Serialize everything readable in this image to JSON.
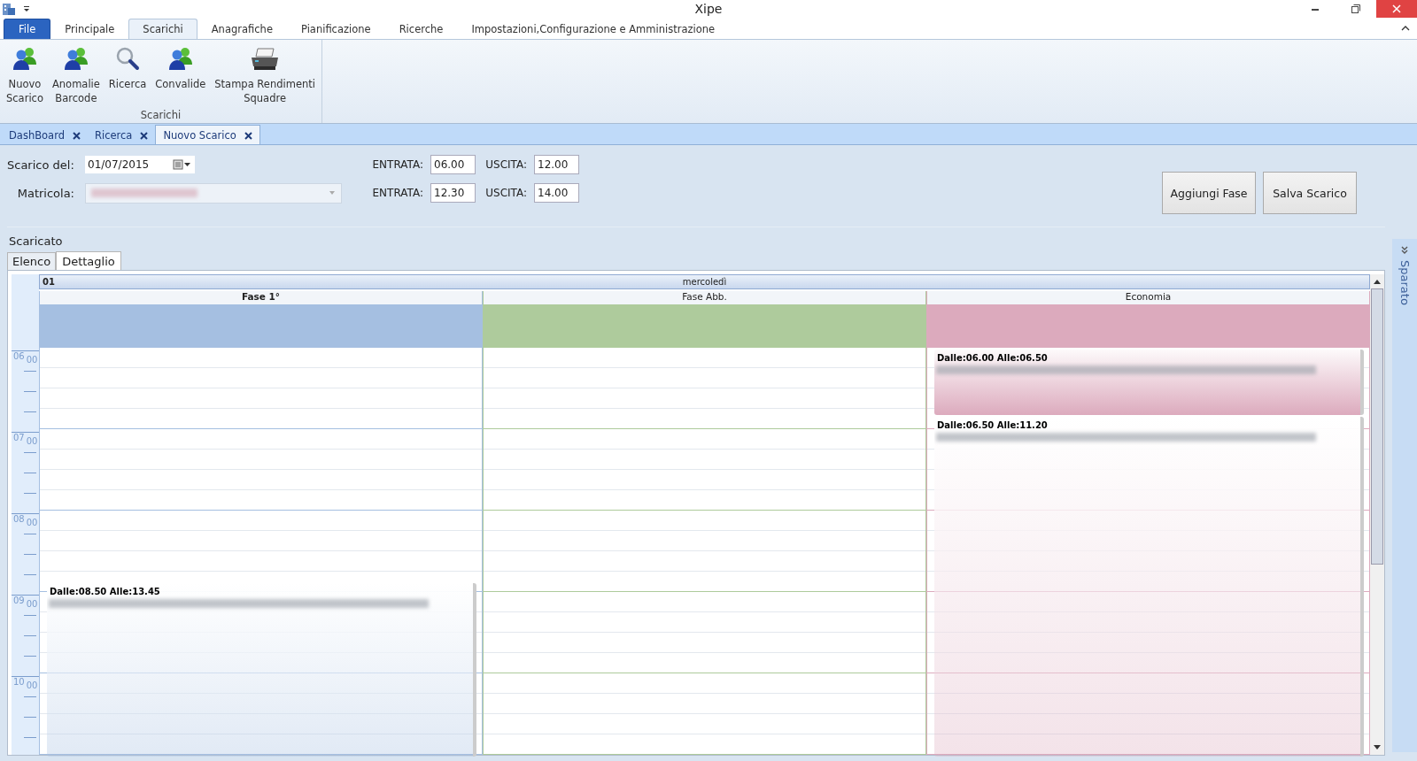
{
  "window": {
    "title": "Xipe"
  },
  "ribbon_tabs": [
    {
      "label": "File",
      "selected": false,
      "kind": "file"
    },
    {
      "label": "Principale",
      "selected": false,
      "kind": "tab"
    },
    {
      "label": "Scarichi",
      "selected": true,
      "kind": "tab"
    },
    {
      "label": "Anagrafiche",
      "selected": false,
      "kind": "tab"
    },
    {
      "label": "Pianificazione",
      "selected": false,
      "kind": "tab"
    },
    {
      "label": "Ricerche",
      "selected": false,
      "kind": "tab"
    },
    {
      "label": "Impostazioni,Configurazione e Amministrazione",
      "selected": false,
      "kind": "tab"
    }
  ],
  "ribbon": {
    "group_label": "Scarichi",
    "buttons": [
      {
        "lines": [
          "Nuovo",
          "Scarico"
        ],
        "kind": "people"
      },
      {
        "lines": [
          "Anomalie",
          "Barcode"
        ],
        "kind": "people"
      },
      {
        "lines": [
          "Ricerca"
        ],
        "kind": "search"
      },
      {
        "lines": [
          "Convalide"
        ],
        "kind": "people"
      },
      {
        "lines": [
          "Stampa Rendimenti",
          "Squadre"
        ],
        "kind": "printer"
      }
    ]
  },
  "doc_tabs": [
    {
      "label": "DashBoard",
      "selected": false
    },
    {
      "label": "Ricerca",
      "selected": false
    },
    {
      "label": "Nuovo Scarico",
      "selected": true
    }
  ],
  "form": {
    "date_label": "Scarico del:",
    "date_value": "01/07/2015",
    "matricola_label": "Matricola:",
    "shifts": [
      {
        "in_label": "ENTRATA:",
        "in_value": "06.00",
        "out_label": "USCITA:",
        "out_value": "12.00"
      },
      {
        "in_label": "ENTRATA:",
        "in_value": "12.30",
        "out_label": "USCITA:",
        "out_value": "14.00"
      }
    ]
  },
  "buttons": [
    "Aggiungi Fase",
    "Salva Scarico"
  ],
  "section_title": "Scaricato",
  "view_tabs": [
    {
      "label": "Elenco",
      "selected": false
    },
    {
      "label": "Dettaglio",
      "selected": true
    }
  ],
  "scheduler": {
    "day_number": "01",
    "day_name": "mercoledì",
    "hours": [
      {
        "hour": "06",
        "minutes": "00"
      },
      {
        "hour": "07",
        "minutes": "00"
      },
      {
        "hour": "08",
        "minutes": "00"
      },
      {
        "hour": "09",
        "minutes": "00"
      },
      {
        "hour": "10",
        "minutes": "00"
      }
    ],
    "resources": [
      {
        "name": "Fase 1°",
        "selected": true,
        "color": "#a5bfe1",
        "appointments": [
          {
            "title": "Dalle:08.50 Alle:13.45"
          }
        ]
      },
      {
        "name": "Fase Abb.",
        "selected": false,
        "color": "#aecb9c"
      },
      {
        "name": "Economia",
        "selected": false,
        "color": "#dcaabd",
        "appointments": [
          {
            "title": "Dalle:06.00 Alle:06.50"
          },
          {
            "title": "Dalle:06.50 Alle:11.20"
          }
        ]
      }
    ]
  },
  "side_panel": {
    "label": "Sparato"
  }
}
